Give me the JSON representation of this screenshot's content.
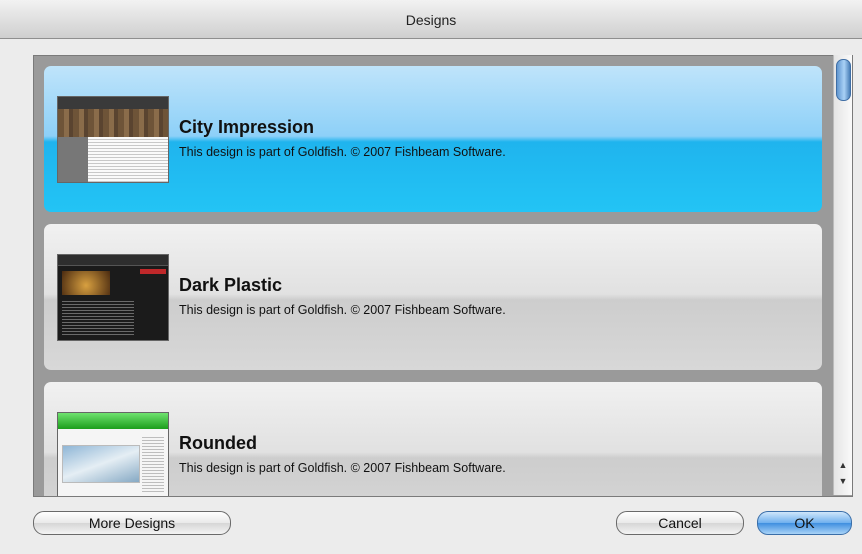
{
  "window": {
    "title": "Designs"
  },
  "designs": [
    {
      "name": "City Impression",
      "description": "This design is part of Goldfish. © 2007 Fishbeam Software.",
      "selected": true
    },
    {
      "name": "Dark Plastic",
      "description": "This design is part of Goldfish. © 2007 Fishbeam Software.",
      "selected": false
    },
    {
      "name": "Rounded",
      "description": "This design is part of Goldfish. © 2007 Fishbeam Software.",
      "selected": false
    }
  ],
  "scrollbar": {
    "up_arrow": "▲",
    "down_arrow": "▼"
  },
  "buttons": {
    "more_designs": "More Designs",
    "cancel": "Cancel",
    "ok": "OK"
  },
  "colors": {
    "selection_top": "#bfe4fa",
    "selection_bottom": "#1fb4ee",
    "default_button": "#3f8fe0"
  }
}
